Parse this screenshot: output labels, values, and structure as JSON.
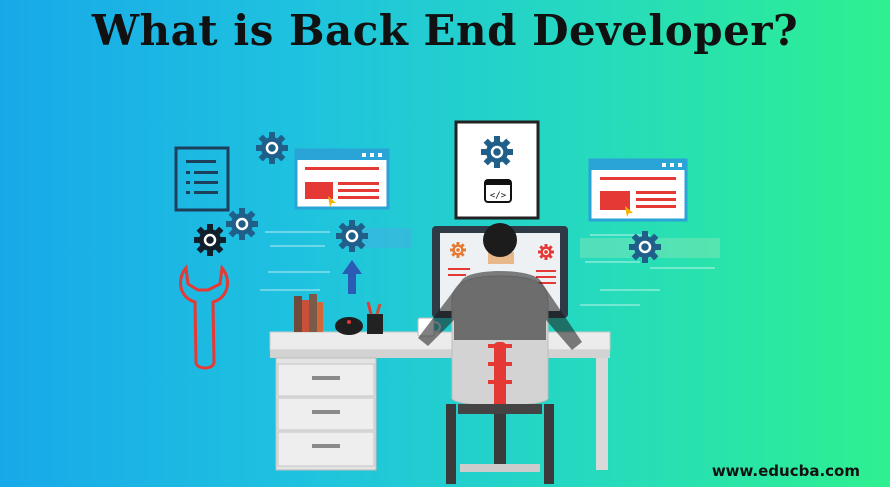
{
  "title": "What is Back End Developer?",
  "footer": {
    "url": "www.educba.com"
  },
  "illustration": {
    "subject": "developer-at-desk",
    "icons": [
      "document-icon",
      "gear-icon",
      "wrench-icon",
      "browser-window-icon",
      "code-icon",
      "arrow-up-icon",
      "monitor-icon",
      "chair-icon",
      "desk-icon",
      "books-icon",
      "mouse-icon",
      "pencil-cup-icon",
      "coffee-mug-icon"
    ]
  },
  "colors": {
    "accent_red": "#e53935",
    "gear_dark": "#173a5a",
    "gear_blue": "#1f5f8a",
    "desk": "#e6e6e6",
    "title_text": "#111111"
  }
}
